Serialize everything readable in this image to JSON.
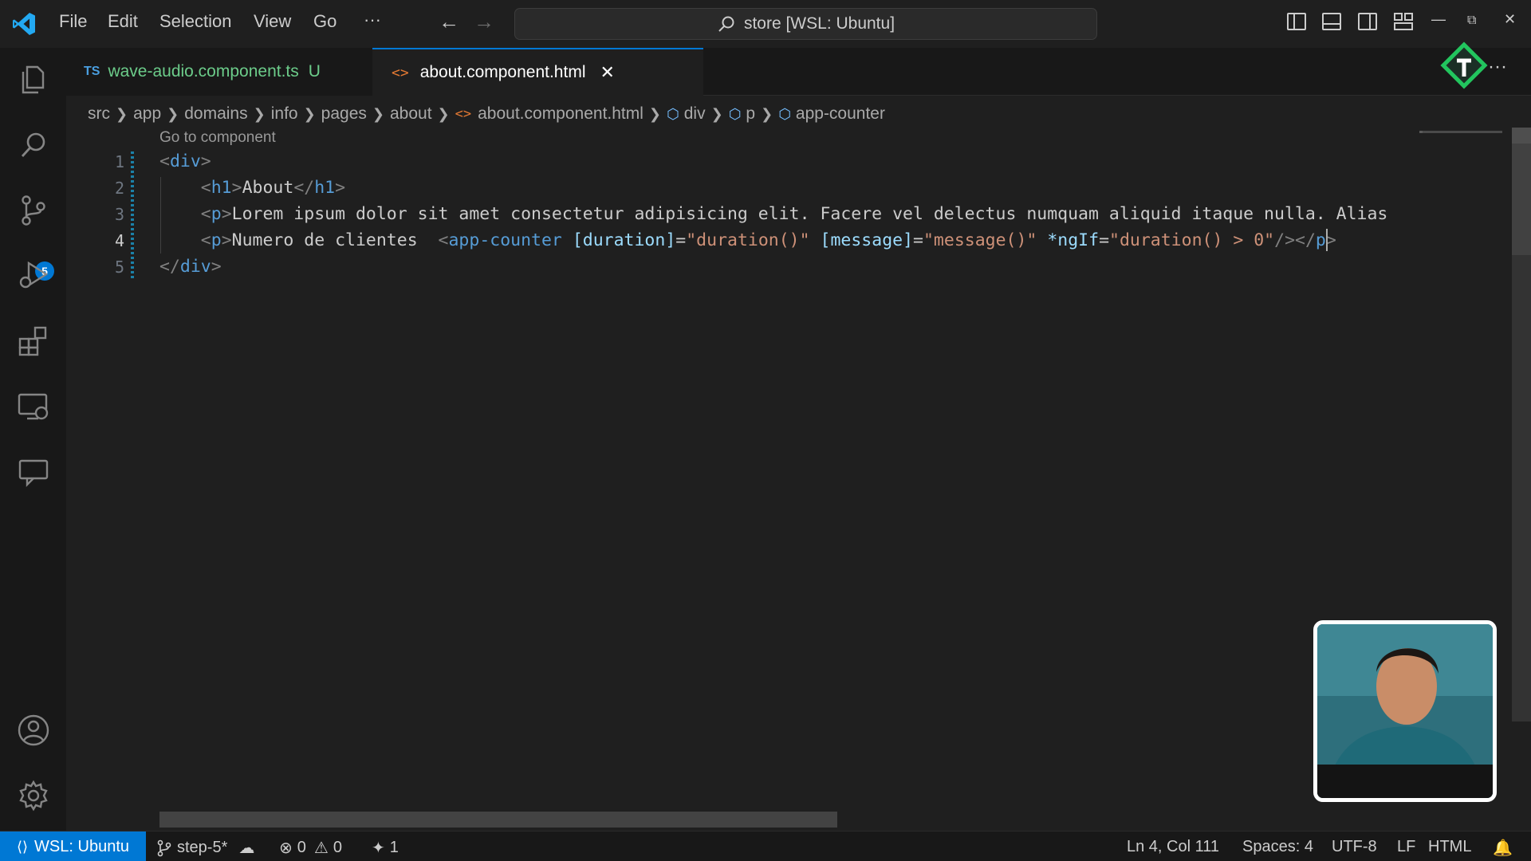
{
  "titlebar": {
    "menu": [
      "File",
      "Edit",
      "Selection",
      "View",
      "Go",
      "···"
    ],
    "search": "store [WSL: Ubuntu]"
  },
  "activity_bar": {
    "items": [
      "explorer-icon",
      "search-icon",
      "source-control-icon",
      "run-debug-icon",
      "extensions-icon",
      "remote-explorer-icon",
      "comments-icon"
    ],
    "bottom": [
      "account-icon",
      "settings-gear-icon"
    ],
    "scm_badge": "5"
  },
  "tabs": [
    {
      "icon": "TS",
      "label": "wave-audio.component.ts",
      "status": "U",
      "active": false
    },
    {
      "icon": "<>",
      "label": "about.component.html",
      "close": "✕",
      "active": true
    }
  ],
  "breadcrumb": [
    "src",
    "app",
    "domains",
    "info",
    "pages",
    "about",
    "about.component.html",
    "div",
    "p",
    "app-counter"
  ],
  "editor": {
    "codelens": "Go to component",
    "line_numbers": [
      "1",
      "2",
      "3",
      "4",
      "5"
    ],
    "current_line": 4,
    "lines": [
      [
        {
          "t": "punct",
          "v": "<"
        },
        {
          "t": "tag",
          "v": "div"
        },
        {
          "t": "punct",
          "v": ">"
        }
      ],
      [
        {
          "t": "text",
          "v": "    "
        },
        {
          "t": "punct",
          "v": "<"
        },
        {
          "t": "tag",
          "v": "h1"
        },
        {
          "t": "punct",
          "v": ">"
        },
        {
          "t": "text",
          "v": "About"
        },
        {
          "t": "punct",
          "v": "</"
        },
        {
          "t": "tag",
          "v": "h1"
        },
        {
          "t": "punct",
          "v": ">"
        }
      ],
      [
        {
          "t": "text",
          "v": "    "
        },
        {
          "t": "punct",
          "v": "<"
        },
        {
          "t": "tag",
          "v": "p"
        },
        {
          "t": "punct",
          "v": ">"
        },
        {
          "t": "text",
          "v": "Lorem ipsum dolor sit amet consectetur adipisicing elit. Facere vel delectus numquam aliquid itaque nulla. Alias"
        }
      ],
      [
        {
          "t": "text",
          "v": "    "
        },
        {
          "t": "punct",
          "v": "<"
        },
        {
          "t": "tag",
          "v": "p"
        },
        {
          "t": "punct",
          "v": ">"
        },
        {
          "t": "text",
          "v": "Numero de clientes  "
        },
        {
          "t": "punct",
          "v": "<"
        },
        {
          "t": "tag",
          "v": "app-counter"
        },
        {
          "t": "text",
          "v": " "
        },
        {
          "t": "attr",
          "v": "[duration]"
        },
        {
          "t": "text",
          "v": "="
        },
        {
          "t": "str",
          "v": "\"duration()\""
        },
        {
          "t": "text",
          "v": " "
        },
        {
          "t": "attr",
          "v": "[message]"
        },
        {
          "t": "text",
          "v": "="
        },
        {
          "t": "str",
          "v": "\"message()\""
        },
        {
          "t": "text",
          "v": " "
        },
        {
          "t": "attr",
          "v": "*ngIf"
        },
        {
          "t": "text",
          "v": "="
        },
        {
          "t": "str",
          "v": "\"duration() > 0\""
        },
        {
          "t": "punct",
          "v": "/>"
        },
        {
          "t": "punct",
          "v": "</"
        },
        {
          "t": "tag",
          "v": "p"
        },
        {
          "t": "punct",
          "v": ">"
        }
      ],
      [
        {
          "t": "punct",
          "v": "</"
        },
        {
          "t": "tag",
          "v": "div"
        },
        {
          "t": "punct",
          "v": ">"
        }
      ]
    ]
  },
  "statusbar": {
    "remote": "WSL: Ubuntu",
    "branch": "step-5*",
    "errors": "0",
    "warnings": "0",
    "ports": "1",
    "position": "Ln 4, Col 111",
    "spaces": "Spaces: 4",
    "encoding": "UTF-8",
    "eol": "LF",
    "language": "HTML"
  },
  "colors": {
    "accent": "#0078d4",
    "tag": "#569cd6",
    "attribute": "#9cdcfe",
    "string": "#ce9178",
    "untracked": "#6ccc8a"
  }
}
